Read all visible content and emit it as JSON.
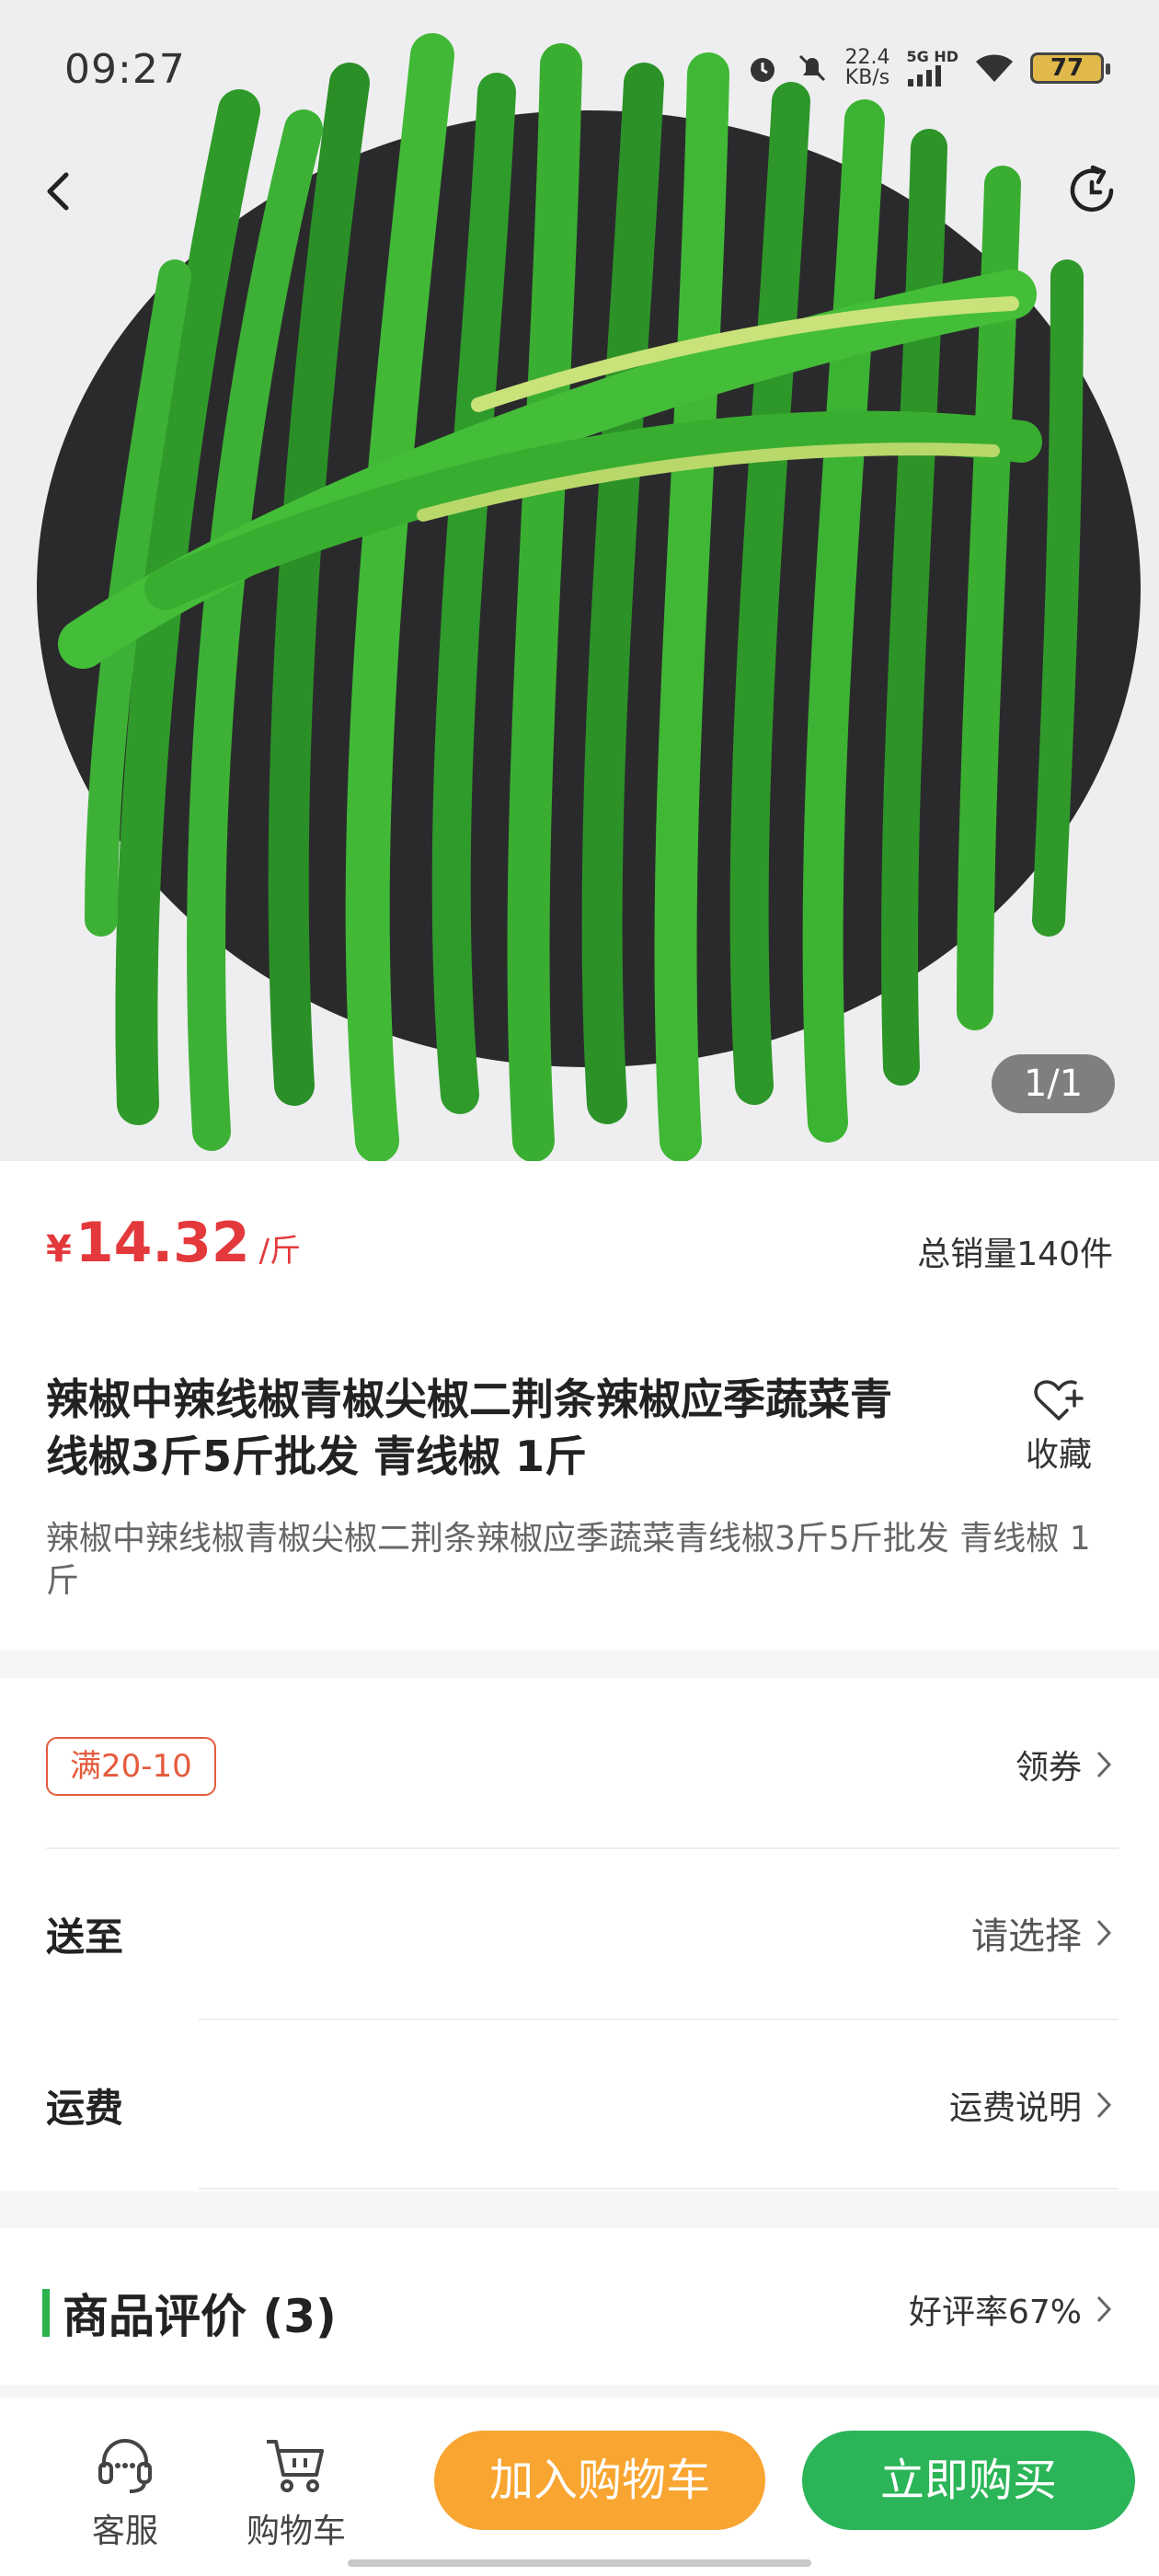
{
  "status": {
    "time": "09:27",
    "net_speed_value": "22.4",
    "net_speed_unit": "KB/s",
    "network": "5G HD",
    "battery": "77",
    "icons": [
      "alarm-icon",
      "mute-icon",
      "signal-icon",
      "wifi-icon",
      "battery-icon"
    ]
  },
  "gallery": {
    "counter": "1/1"
  },
  "price": {
    "currency": "¥",
    "value": "14.32",
    "unit": "/斤",
    "sales": "总销量140件",
    "color": "#e4393c"
  },
  "product": {
    "title": "辣椒中辣线椒青椒尖椒二荆条辣椒应季蔬菜青线椒3斤5斤批发 青线椒 1斤",
    "subtitle": "辣椒中辣线椒青椒尖椒二荆条辣椒应季蔬菜青线椒3斤5斤批发 青线椒 1斤",
    "favorite_label": "收藏"
  },
  "coupon": {
    "tag": "满20-10",
    "link": "领券"
  },
  "delivery": {
    "label": "送至",
    "value": "请选择"
  },
  "shipping": {
    "label": "运费",
    "link": "运费说明"
  },
  "reviews": {
    "title": "商品评价 (3)",
    "rating": "好评率67%",
    "accent_color": "#2bb24c"
  },
  "bottom_bar": {
    "service_label": "客服",
    "cart_label": "购物车",
    "add_to_cart": "加入购物车",
    "buy_now": "立即购买",
    "add_color": "#f8a531",
    "buy_color": "#2bb558"
  }
}
